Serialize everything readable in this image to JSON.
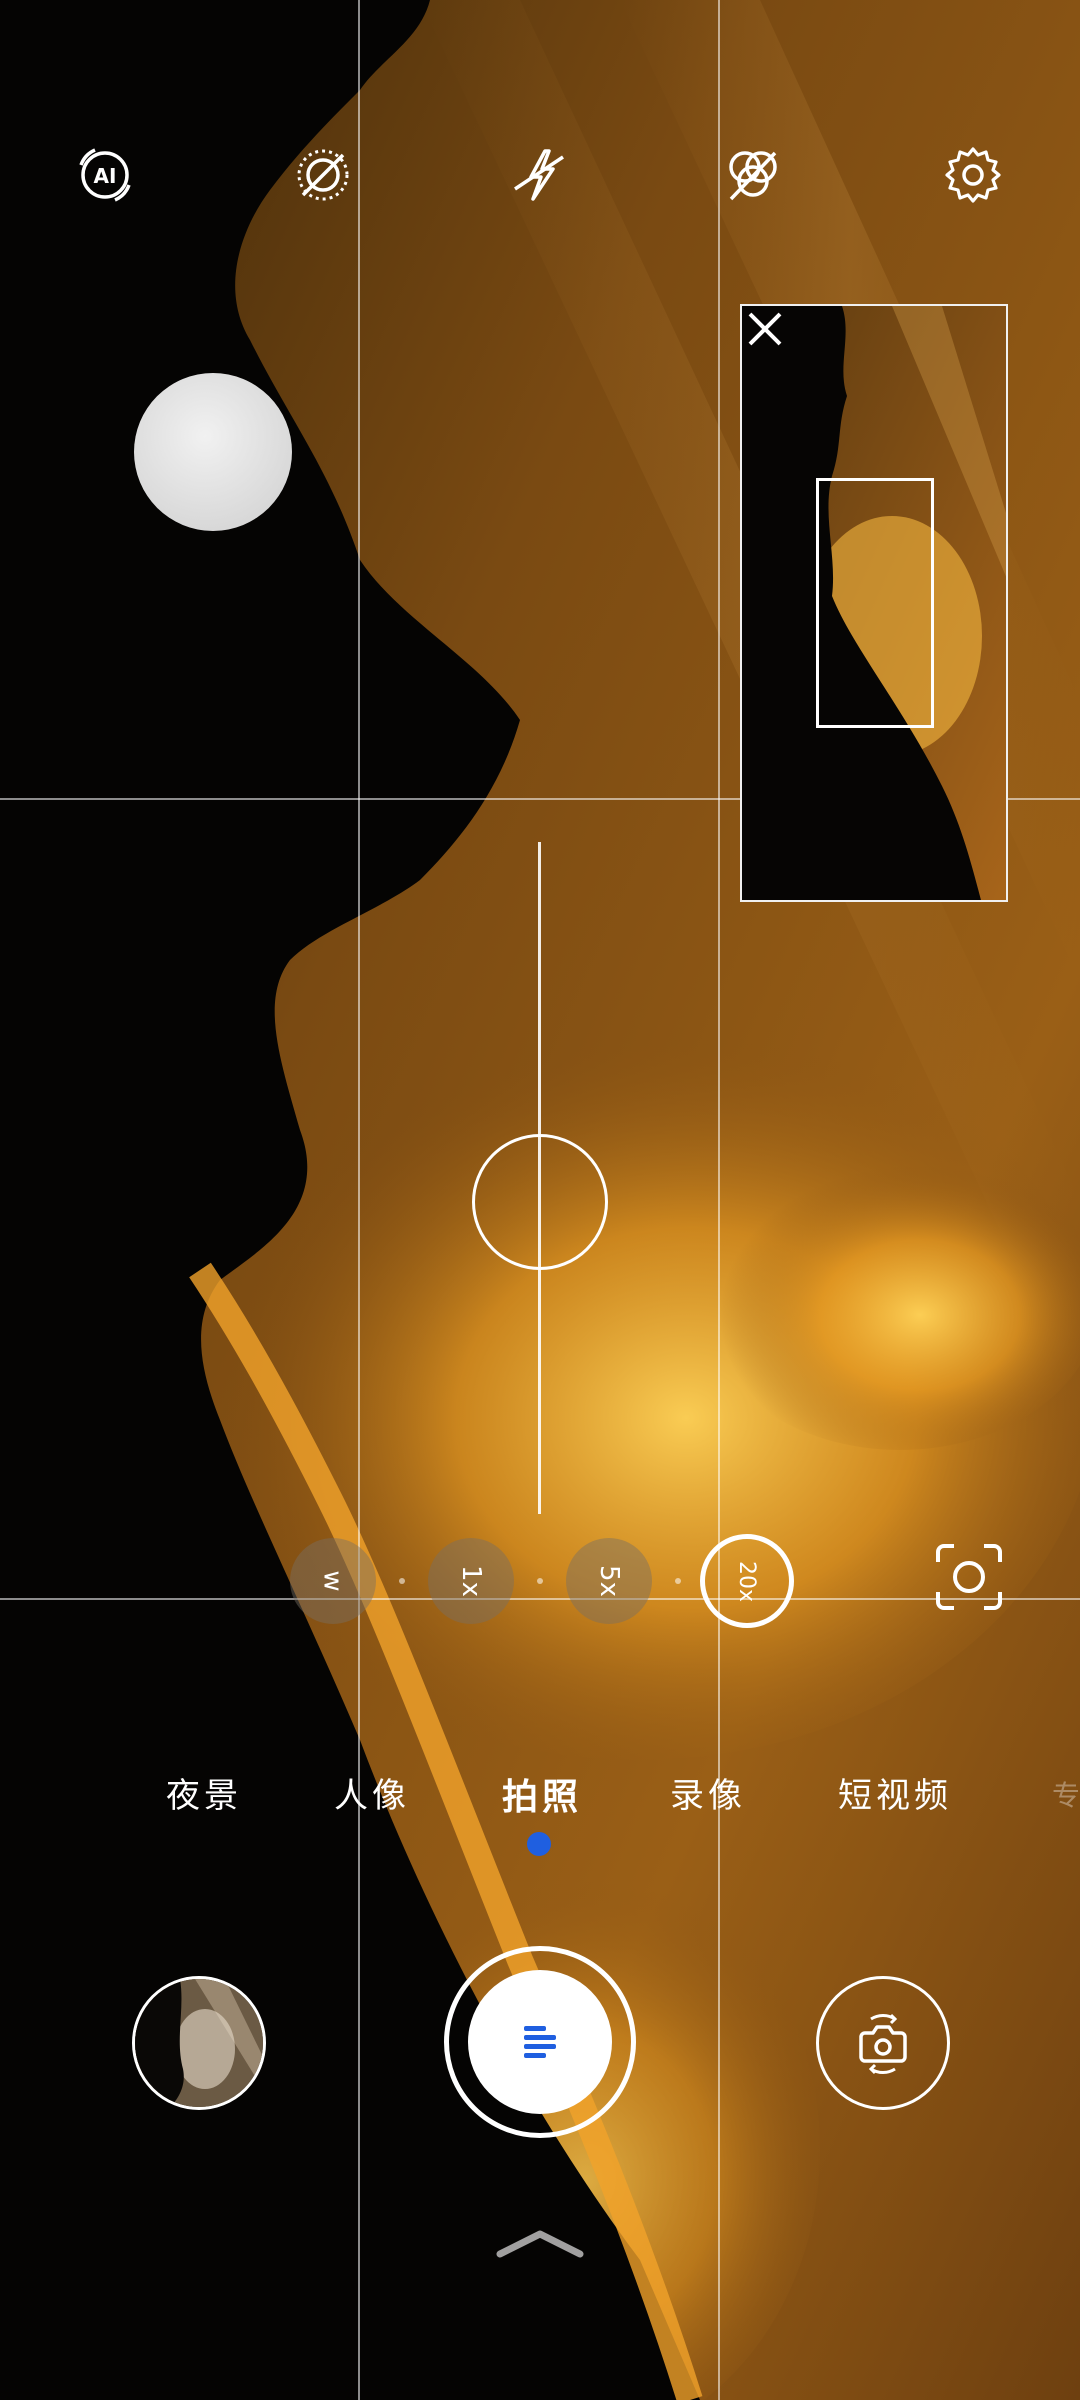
{
  "top_bar": {
    "icons": [
      "ai-icon",
      "aperture-off-icon",
      "flash-off-icon",
      "filter-off-icon",
      "gear-icon"
    ]
  },
  "navigator": {
    "close_icon": "close-icon"
  },
  "zoom": {
    "level_fraction": 1.0,
    "presets": [
      {
        "label": "w"
      },
      {
        "label": "1x"
      },
      {
        "label": "5x"
      },
      {
        "label": "20x",
        "active": true
      }
    ],
    "scan_icon": "scan-icon"
  },
  "modes": {
    "items": [
      "夜景",
      "人像",
      "拍照",
      "录像",
      "短视频"
    ],
    "active": "拍照",
    "next_partial": "专"
  },
  "bottom": {
    "gallery_icon": "gallery-thumbnail",
    "shutter_icon": "menu-icon",
    "flip_icon": "flip-camera-icon",
    "swipe_icon": "chevron-up-icon"
  },
  "colors": {
    "accent": "#1f5fe0",
    "sky_dark": "#3a2208",
    "sky_glow": "#f4b43a"
  }
}
